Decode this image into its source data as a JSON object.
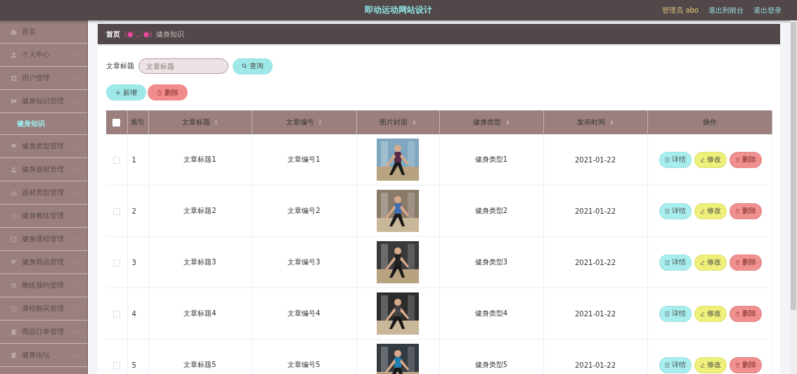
{
  "header": {
    "title": "即动运动网站设计",
    "user": "管理员 abo",
    "links": [
      "退出到前台",
      "退出登录"
    ]
  },
  "sidebar": {
    "items": [
      {
        "kind": "link",
        "label": "首页"
      },
      {
        "kind": "group",
        "label": "个人中心",
        "expanded": false
      },
      {
        "kind": "group",
        "label": "用户管理",
        "expanded": false
      },
      {
        "kind": "group",
        "label": "健身知识管理",
        "expanded": true,
        "children": [
          {
            "label": "健身知识",
            "selected": true
          }
        ]
      },
      {
        "kind": "group",
        "label": "健身类型管理",
        "expanded": false
      },
      {
        "kind": "group",
        "label": "健身器材管理",
        "expanded": false
      },
      {
        "kind": "group",
        "label": "器材类型管理",
        "expanded": false
      },
      {
        "kind": "group",
        "label": "健身教练管理",
        "expanded": false
      },
      {
        "kind": "group",
        "label": "健身课程管理",
        "expanded": false
      },
      {
        "kind": "group",
        "label": "健身商品管理",
        "expanded": false
      },
      {
        "kind": "group",
        "label": "教练预约管理",
        "expanded": false
      },
      {
        "kind": "group",
        "label": "课程购买管理",
        "expanded": false
      },
      {
        "kind": "group",
        "label": "商品订单管理",
        "expanded": false
      },
      {
        "kind": "group",
        "label": "健身论坛",
        "expanded": false
      }
    ]
  },
  "breadcrumb": {
    "home": "首页",
    "separator": "(●'◡'●)",
    "current": "健身知识"
  },
  "search": {
    "label": "文章标题",
    "placeholder": "文章标题",
    "button": "查询"
  },
  "toolbar": [
    {
      "kind": "add",
      "label": "新增"
    },
    {
      "kind": "delete",
      "label": "删除"
    }
  ],
  "table": {
    "select_all": {
      "checked": false
    },
    "columns": [
      {
        "label": "索引",
        "sortable": false
      },
      {
        "label": "文章标题",
        "sortable": true
      },
      {
        "label": "文章编号",
        "sortable": true
      },
      {
        "label": "图片封面",
        "sortable": true
      },
      {
        "label": "健身类型",
        "sortable": true
      },
      {
        "label": "发布时间",
        "sortable": true
      },
      {
        "label": "操作",
        "sortable": false
      }
    ],
    "rows": [
      {
        "checked": false,
        "index": "1",
        "title": "文章标题1",
        "code": "文章编号1",
        "type": "健身类型1",
        "date": "2021-01-22",
        "actions": [
          {
            "kind": "detail",
            "label": "详情"
          },
          {
            "kind": "edit",
            "label": "修改"
          },
          {
            "kind": "delete",
            "label": "删除"
          }
        ]
      },
      {
        "checked": false,
        "index": "2",
        "title": "文章标题2",
        "code": "文章编号2",
        "type": "健身类型2",
        "date": "2021-01-22",
        "actions": [
          {
            "kind": "detail",
            "label": "详情"
          },
          {
            "kind": "edit",
            "label": "修改"
          },
          {
            "kind": "delete",
            "label": "删除"
          }
        ]
      },
      {
        "checked": false,
        "index": "3",
        "title": "文章标题3",
        "code": "文章编号3",
        "type": "健身类型3",
        "date": "2021-01-22",
        "actions": [
          {
            "kind": "detail",
            "label": "详情"
          },
          {
            "kind": "edit",
            "label": "修改"
          },
          {
            "kind": "delete",
            "label": "删除"
          }
        ]
      },
      {
        "checked": false,
        "index": "4",
        "title": "文章标题4",
        "code": "文章编号4",
        "type": "健身类型4",
        "date": "2021-01-22",
        "actions": [
          {
            "kind": "detail",
            "label": "详情"
          },
          {
            "kind": "edit",
            "label": "修改"
          },
          {
            "kind": "delete",
            "label": "删除"
          }
        ]
      },
      {
        "checked": false,
        "index": "5",
        "title": "文章标题5",
        "code": "文章编号5",
        "type": "健身类型5",
        "date": "2021-01-22",
        "actions": [
          {
            "kind": "detail",
            "label": "详情"
          },
          {
            "kind": "edit",
            "label": "修改"
          },
          {
            "kind": "delete",
            "label": "删除"
          }
        ]
      }
    ]
  }
}
